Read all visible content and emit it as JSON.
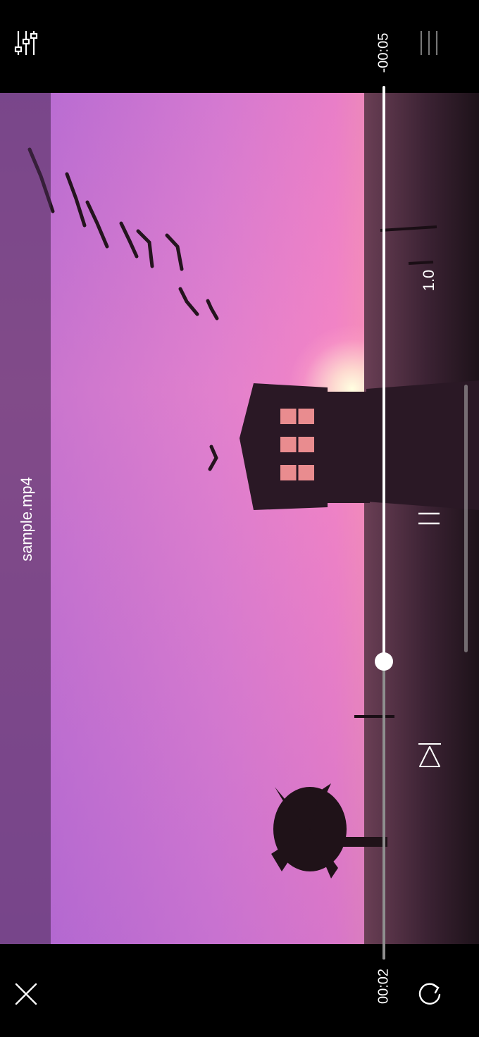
{
  "player": {
    "filename": "sample.mp4",
    "time_remaining": "-00:05",
    "time_elapsed": "00:02",
    "playback_speed": "1.0",
    "progress": 0.29,
    "state": "playing"
  },
  "icons": {
    "top_left": "equalizer-sliders-icon",
    "top_right": "menu-icon",
    "pause": "pause-icon",
    "skip_next": "skip-next-icon",
    "close": "close-icon",
    "rotate": "rotate-icon"
  },
  "colors": {
    "background": "#000000",
    "seek_unplayed": "#ffffff",
    "seek_played": "#8f8f8f",
    "text": "#ffffff"
  }
}
